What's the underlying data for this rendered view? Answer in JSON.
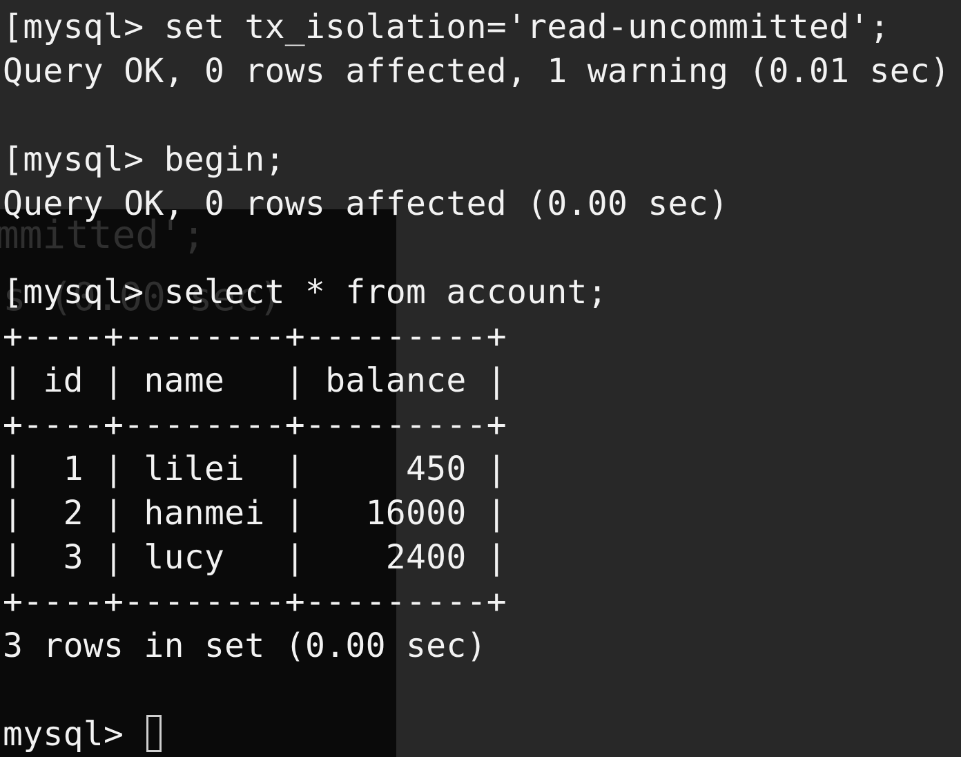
{
  "background_window": {
    "ghost_text_1": "mmitted';",
    "ghost_text_2": "s (0.00 sec)"
  },
  "terminal": {
    "lines": [
      "[mysql> set tx_isolation='read-uncommitted';",
      "Query OK, 0 rows affected, 1 warning (0.01 sec)",
      "",
      "[mysql> begin;",
      "Query OK, 0 rows affected (0.00 sec)",
      "",
      "[mysql> select * from account;",
      "+----+--------+---------+",
      "| id | name   | balance |",
      "+----+--------+---------+",
      "|  1 | lilei  |     450 |",
      "|  2 | hanmei |   16000 |",
      "|  3 | lucy   |    2400 |",
      "+----+--------+---------+",
      "3 rows in set (0.00 sec)",
      "",
      "mysql> "
    ]
  },
  "colors": {
    "terminal_bg": "#282828",
    "overlay_bg": "#0a0a0a",
    "text": "#f2f2f2"
  }
}
